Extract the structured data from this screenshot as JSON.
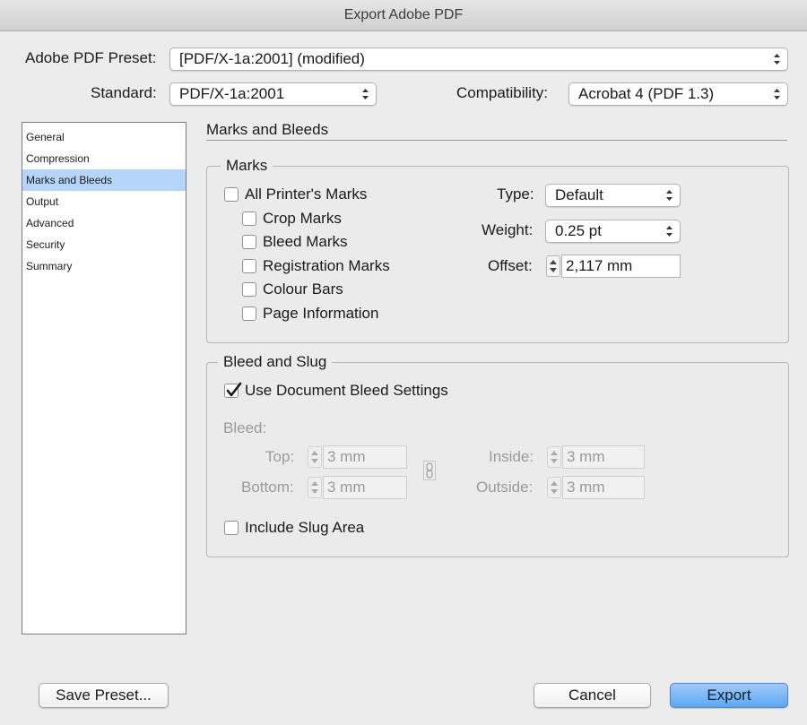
{
  "window": {
    "title": "Export Adobe PDF"
  },
  "preset": {
    "label": "Adobe PDF Preset:",
    "value": "[PDF/X-1a:2001] (modified)"
  },
  "standard": {
    "label": "Standard:",
    "value": "PDF/X-1a:2001"
  },
  "compatibility": {
    "label": "Compatibility:",
    "value": "Acrobat 4 (PDF 1.3)"
  },
  "sidebar": {
    "items": [
      {
        "label": "General"
      },
      {
        "label": "Compression"
      },
      {
        "label": "Marks and Bleeds"
      },
      {
        "label": "Output"
      },
      {
        "label": "Advanced"
      },
      {
        "label": "Security"
      },
      {
        "label": "Summary"
      }
    ],
    "selected": "Marks and Bleeds"
  },
  "section": {
    "title": "Marks and Bleeds"
  },
  "marks": {
    "title": "Marks",
    "all_printers_marks": "All Printer's Marks",
    "crop_marks": "Crop Marks",
    "bleed_marks": "Bleed Marks",
    "registration_marks": "Registration Marks",
    "colour_bars": "Colour Bars",
    "page_information": "Page Information",
    "type_label": "Type:",
    "type_value": "Default",
    "weight_label": "Weight:",
    "weight_value": "0.25 pt",
    "offset_label": "Offset:",
    "offset_value": "2,117 mm"
  },
  "bleed": {
    "title": "Bleed and Slug",
    "use_document": "Use Document Bleed Settings",
    "use_document_checked": true,
    "bleed_label": "Bleed:",
    "top_label": "Top:",
    "top_value": "3 mm",
    "bottom_label": "Bottom:",
    "bottom_value": "3 mm",
    "inside_label": "Inside:",
    "inside_value": "3 mm",
    "outside_label": "Outside:",
    "outside_value": "3 mm",
    "include_slug": "Include Slug Area",
    "include_slug_checked": false
  },
  "buttons": {
    "save_preset": "Save Preset...",
    "cancel": "Cancel",
    "export": "Export"
  },
  "colors": {
    "selection": "#b5d5fb",
    "primary_button": "#5ea6f2"
  },
  "icons": {
    "link": "chain-link-icon",
    "popup_arrows": "up-down-arrows-icon"
  }
}
